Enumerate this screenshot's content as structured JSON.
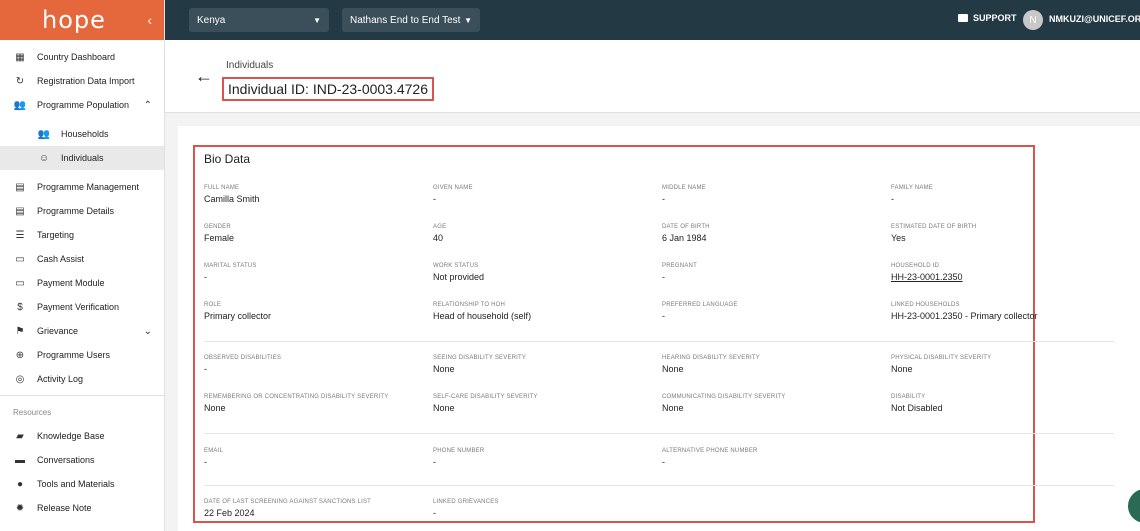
{
  "sidebar": {
    "logo": "hope",
    "items": [
      {
        "label": "Country Dashboard",
        "icon": "dashboard-icon"
      },
      {
        "label": "Registration Data Import",
        "icon": "refresh-icon"
      },
      {
        "label": "Programme Population",
        "icon": "people-icon"
      },
      {
        "label": "Households",
        "icon": "households-icon"
      },
      {
        "label": "Individuals",
        "icon": "individual-icon"
      },
      {
        "label": "Programme Management",
        "icon": "clipboard-icon"
      },
      {
        "label": "Programme Details",
        "icon": "clipboard-icon"
      },
      {
        "label": "Targeting",
        "icon": "list-icon"
      },
      {
        "label": "Cash Assist",
        "icon": "card-icon"
      },
      {
        "label": "Payment Module",
        "icon": "card-icon"
      },
      {
        "label": "Payment Verification",
        "icon": "dollar-icon"
      },
      {
        "label": "Grievance",
        "icon": "flag-icon"
      },
      {
        "label": "Programme Users",
        "icon": "globe-icon"
      },
      {
        "label": "Activity Log",
        "icon": "fingerprint-icon"
      }
    ],
    "resources_label": "Resources",
    "resources": [
      {
        "label": "Knowledge Base",
        "icon": "book-icon"
      },
      {
        "label": "Conversations",
        "icon": "chat-icon"
      },
      {
        "label": "Tools and Materials",
        "icon": "info-icon"
      },
      {
        "label": "Release Note",
        "icon": "gear-icon"
      }
    ]
  },
  "topbar": {
    "country": "Kenya",
    "programme": "Nathans End to End Test",
    "support": "SUPPORT",
    "avatar_initial": "N",
    "user": "NMKUZI@UNICEF.ORG"
  },
  "header": {
    "breadcrumb": "Individuals",
    "title": "Individual ID: IND-23-0003.4726"
  },
  "bio": {
    "title": "Bio Data",
    "fields": {
      "full_name": {
        "label": "FULL NAME",
        "value": "Camilla Smith"
      },
      "given_name": {
        "label": "GIVEN NAME",
        "value": "-"
      },
      "middle_name": {
        "label": "MIDDLE NAME",
        "value": "-"
      },
      "family_name": {
        "label": "FAMILY NAME",
        "value": "-"
      },
      "gender": {
        "label": "GENDER",
        "value": "Female"
      },
      "age": {
        "label": "AGE",
        "value": "40"
      },
      "dob": {
        "label": "DATE OF BIRTH",
        "value": "6 Jan 1984"
      },
      "est_dob": {
        "label": "ESTIMATED DATE OF BIRTH",
        "value": "Yes"
      },
      "marital": {
        "label": "MARITAL STATUS",
        "value": "-"
      },
      "work": {
        "label": "WORK STATUS",
        "value": "Not provided"
      },
      "pregnant": {
        "label": "PREGNANT",
        "value": "-"
      },
      "household_id": {
        "label": "HOUSEHOLD ID",
        "value": "HH-23-0001.2350"
      },
      "role": {
        "label": "ROLE",
        "value": "Primary collector"
      },
      "relationship": {
        "label": "RELATIONSHIP TO HOH",
        "value": "Head of household (self)"
      },
      "language": {
        "label": "PREFERRED LANGUAGE",
        "value": "-"
      },
      "linked_households": {
        "label": "LINKED HOUSEHOLDS",
        "value": "HH-23-0001.2350 - Primary collector"
      },
      "observed_disabilities": {
        "label": "OBSERVED DISABILITIES",
        "value": "-"
      },
      "seeing": {
        "label": "SEEING DISABILITY SEVERITY",
        "value": "None"
      },
      "hearing": {
        "label": "HEARING DISABILITY SEVERITY",
        "value": "None"
      },
      "physical": {
        "label": "PHYSICAL DISABILITY SEVERITY",
        "value": "None"
      },
      "remembering": {
        "label": "REMEMBERING OR CONCENTRATING DISABILITY SEVERITY",
        "value": "None"
      },
      "selfcare": {
        "label": "SELF-CARE DISABILITY SEVERITY",
        "value": "None"
      },
      "communicating": {
        "label": "COMMUNICATING DISABILITY SEVERITY",
        "value": "None"
      },
      "disability": {
        "label": "DISABILITY",
        "value": "Not Disabled"
      },
      "email": {
        "label": "EMAIL",
        "value": "-"
      },
      "phone": {
        "label": "PHONE NUMBER",
        "value": "-"
      },
      "alt_phone": {
        "label": "ALTERNATIVE PHONE NUMBER",
        "value": "-"
      },
      "sanctions": {
        "label": "DATE OF LAST SCREENING AGAINST SANCTIONS LIST",
        "value": "22 Feb 2024"
      },
      "grievances": {
        "label": "LINKED GRIEVANCES",
        "value": "-"
      }
    }
  },
  "colors": {
    "brand": "#e5683c",
    "topbar": "#233944",
    "highlight": "#d9534f"
  }
}
